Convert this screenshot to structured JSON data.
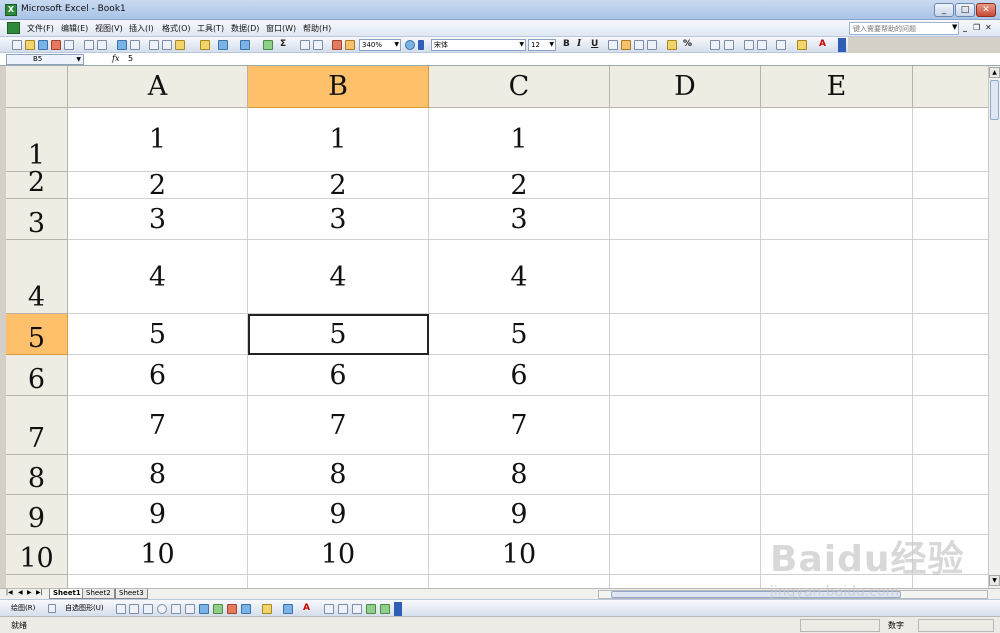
{
  "app": {
    "title": "Microsoft Excel - Book1",
    "icon": "excel-icon",
    "window_buttons": [
      "_",
      "□",
      "✕"
    ]
  },
  "menu": {
    "items": [
      "文件(F)",
      "编辑(E)",
      "视图(V)",
      "插入(I)",
      "格式(O)",
      "工具(T)",
      "数据(D)",
      "窗口(W)",
      "帮助(H)"
    ],
    "help_placeholder": "键入需要帮助的问题",
    "mdi_buttons": [
      "_",
      "❐",
      "✕"
    ]
  },
  "toolbar": {
    "zoom": "340%",
    "font": "宋体",
    "font_size": "12",
    "bold": "B",
    "italic": "I",
    "underline": "U",
    "autosum": "Σ",
    "percent": "%",
    "font_color": "A"
  },
  "formula_bar": {
    "name_box": "B5",
    "fx": "fx",
    "value": "5"
  },
  "grid": {
    "columns": [
      "A",
      "B",
      "C",
      "D",
      "E"
    ],
    "active_column": "B",
    "active_row": "5",
    "rows": [
      {
        "label": "1",
        "cells": [
          "1",
          "1",
          "1"
        ]
      },
      {
        "label": "2",
        "cells": [
          "2",
          "2",
          "2"
        ]
      },
      {
        "label": "3",
        "cells": [
          "3",
          "3",
          "3"
        ]
      },
      {
        "label": "4",
        "cells": [
          "4",
          "4",
          "4"
        ]
      },
      {
        "label": "5",
        "cells": [
          "5",
          "5",
          "5"
        ]
      },
      {
        "label": "6",
        "cells": [
          "6",
          "6",
          "6"
        ]
      },
      {
        "label": "7",
        "cells": [
          "7",
          "7",
          "7"
        ]
      },
      {
        "label": "8",
        "cells": [
          "8",
          "8",
          "8"
        ]
      },
      {
        "label": "9",
        "cells": [
          "9",
          "9",
          "9"
        ]
      },
      {
        "label": "10",
        "cells": [
          "10",
          "10",
          "10"
        ]
      }
    ]
  },
  "sheets": {
    "tabs": [
      "Sheet1",
      "Sheet2",
      "Sheet3"
    ],
    "active": "Sheet1",
    "nav": [
      "|◀",
      "◀",
      "▶",
      "▶|"
    ]
  },
  "drawing_toolbar": {
    "draw_label": "绘图(R)",
    "autoshapes_label": "自选图形(U)"
  },
  "status": {
    "text": "就绪",
    "mode": "数字"
  },
  "watermark": {
    "brand": "Baidu经验",
    "url": "jingyan.baidu.com"
  },
  "colors": {
    "active_header": "#ffc06c",
    "header_bg": "#efece4",
    "title_gradient": "#a9c4e8"
  }
}
